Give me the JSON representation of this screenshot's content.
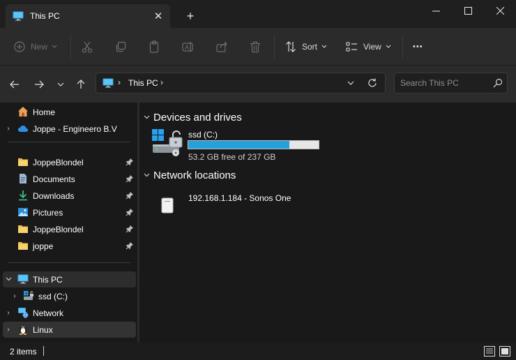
{
  "tab": {
    "title": "This PC",
    "close": "✕",
    "new_tab": "+"
  },
  "window": {
    "minimize": "—",
    "maximize": "☐",
    "close": "✕"
  },
  "command_bar": {
    "new_label": "New",
    "sort_label": "Sort",
    "view_label": "View",
    "more": "•••"
  },
  "address": {
    "path": [
      "This PC"
    ],
    "search_placeholder": "Search This PC"
  },
  "sidebar": {
    "items": [
      {
        "label": "Home",
        "icon": "home-icon"
      },
      {
        "label": "Joppe - Engineero B.V",
        "icon": "onedrive-cloud-icon"
      },
      {
        "label": "JoppeBlondel",
        "icon": "folder-icon",
        "pinned": true
      },
      {
        "label": "Documents",
        "icon": "documents-icon",
        "pinned": true
      },
      {
        "label": "Downloads",
        "icon": "downloads-icon",
        "pinned": true
      },
      {
        "label": "Pictures",
        "icon": "pictures-icon",
        "pinned": true
      },
      {
        "label": "JoppeBlondel",
        "icon": "folder-icon",
        "pinned": true
      },
      {
        "label": "joppe",
        "icon": "folder-icon",
        "pinned": true
      },
      {
        "label": "This PC",
        "icon": "monitor-icon",
        "expanded": true,
        "selected": true
      },
      {
        "label": "ssd (C:)",
        "icon": "drive-icon"
      },
      {
        "label": "Network",
        "icon": "network-icon"
      },
      {
        "label": "Linux",
        "icon": "linux-penguin-icon"
      }
    ]
  },
  "content": {
    "devices_title": "Devices and drives",
    "drive": {
      "name": "ssd (C:)",
      "free_text": "53.2 GB free of 237 GB",
      "used_fraction": 0.776
    },
    "network_title": "Network locations",
    "network_item": {
      "name": "192.168.1.184 - Sonos One"
    }
  },
  "status": {
    "count": "2 items"
  },
  "colors": {
    "accent": "#26a0da",
    "folder": "#f2c14e",
    "bg": "#191919",
    "chrome": "#2b2b2b"
  }
}
